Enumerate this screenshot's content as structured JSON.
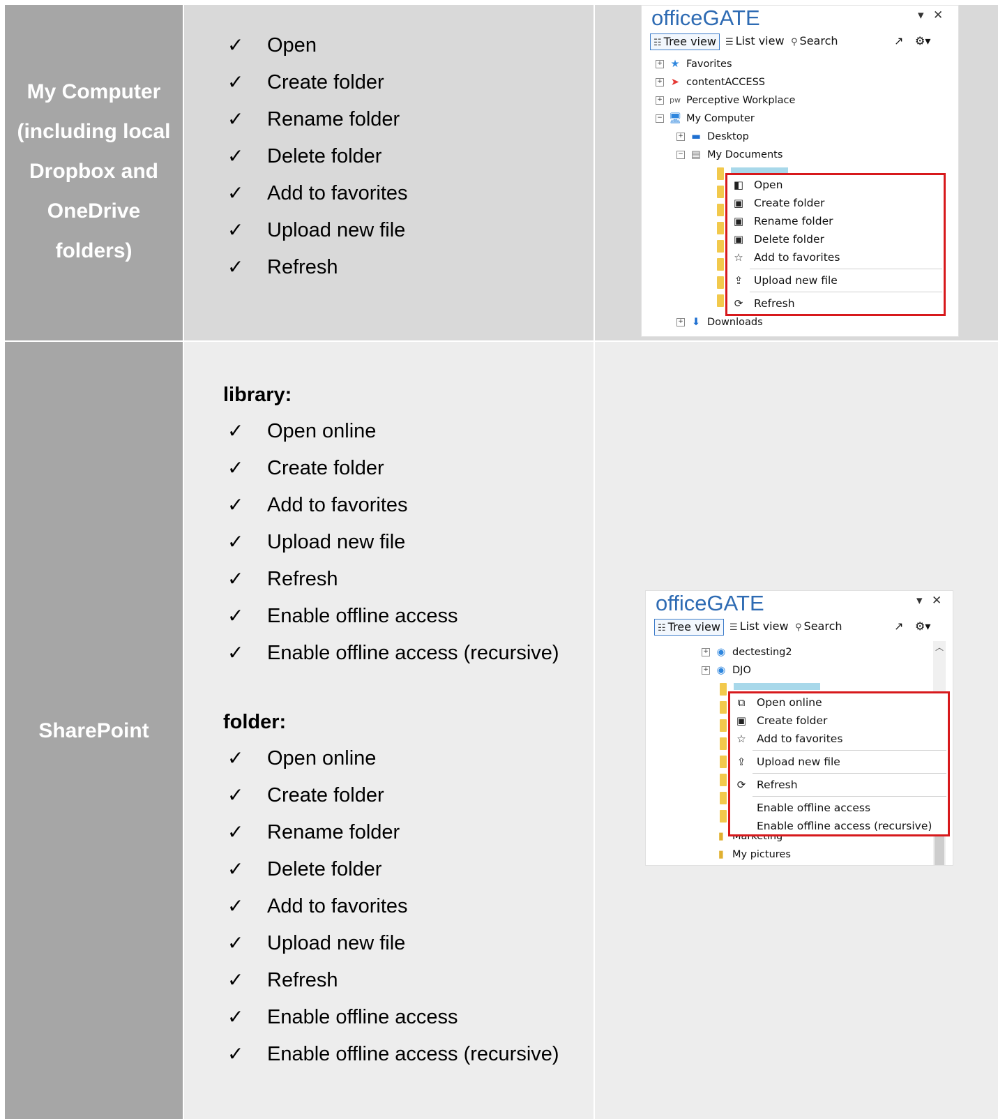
{
  "rows": [
    {
      "heading_lines": [
        "My Computer",
        "(including local",
        "Dropbox and",
        "OneDrive",
        "folders)"
      ],
      "items": [
        "Open",
        "Create folder",
        "Rename folder",
        "Delete folder",
        "Add to favorites",
        "Upload new file",
        "Refresh"
      ]
    },
    {
      "heading": "SharePoint",
      "library_label": "library:",
      "library_items": [
        "Open online",
        "Create folder",
        "Add to favorites",
        "Upload new file",
        "Refresh",
        "Enable offline access",
        "Enable offline access (recursive)"
      ],
      "folder_label": "folder:",
      "folder_items": [
        "Open online",
        "Create folder",
        "Rename folder",
        "Delete folder",
        "Add to favorites",
        "Upload new file",
        "Refresh",
        "Enable offline access",
        "Enable offline access (recursive)"
      ]
    }
  ],
  "check_glyph": "✓",
  "panel1": {
    "title": "officeGATE",
    "tabs": [
      "Tree view",
      "List view",
      "Search"
    ],
    "tree": [
      "Favorites",
      "contentACCESS",
      "Perceptive Workplace",
      "My Computer",
      "Desktop",
      "My Documents",
      "Downloads"
    ],
    "menu": [
      "Open",
      "Create folder",
      "Rename folder",
      "Delete folder",
      "Add to favorites",
      "Upload new file",
      "Refresh"
    ]
  },
  "panel2": {
    "title": "officeGATE",
    "tabs": [
      "Tree view",
      "List view",
      "Search"
    ],
    "tree": [
      "dectesting2",
      "DJO",
      "Marketing",
      "My pictures"
    ],
    "menu": [
      "Open online",
      "Create folder",
      "Add to favorites",
      "Upload new file",
      "Refresh",
      "Enable offline access",
      "Enable offline access (recursive)"
    ]
  },
  "colors": {
    "header_bg": "#a6a6a6",
    "row1_bg": "#d9d9d9",
    "row2_bg": "#ededed",
    "menu_border": "#d7191c",
    "brand": "#2e6bb3"
  }
}
